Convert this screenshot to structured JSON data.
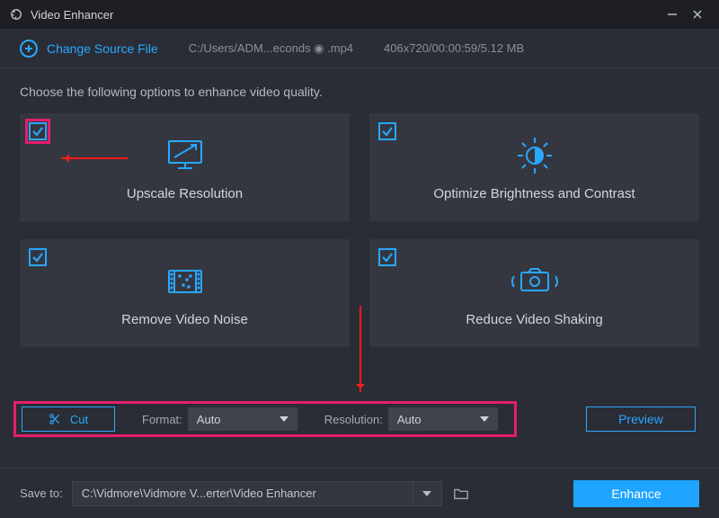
{
  "window": {
    "title": "Video Enhancer"
  },
  "header": {
    "change_source_label": "Change Source File",
    "source_path": "C:/Users/ADM...econds ◉ .mp4",
    "source_info": "406x720/00:00:59/5.12 MB"
  },
  "instruction": "Choose the following options to enhance video quality.",
  "cards": {
    "upscale": {
      "label": "Upscale Resolution",
      "checked": true,
      "highlighted": true
    },
    "brightness": {
      "label": "Optimize Brightness and Contrast",
      "checked": true
    },
    "noise": {
      "label": "Remove Video Noise",
      "checked": true
    },
    "shake": {
      "label": "Reduce Video Shaking",
      "checked": true
    }
  },
  "controls": {
    "cut_label": "Cut",
    "format_label": "Format:",
    "format_value": "Auto",
    "resolution_label": "Resolution:",
    "resolution_value": "Auto",
    "preview_label": "Preview"
  },
  "footer": {
    "save_to_label": "Save to:",
    "save_path": "C:\\Vidmore\\Vidmore V...erter\\Video Enhancer",
    "enhance_label": "Enhance"
  }
}
